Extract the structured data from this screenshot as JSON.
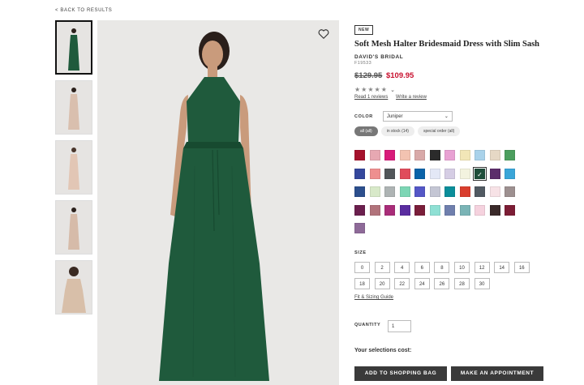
{
  "nav": {
    "back": "< BACK TO RESULTS"
  },
  "product": {
    "badge": "NEW",
    "title": "Soft Mesh Halter Bridesmaid Dress with Slim Sash",
    "brand": "DAVID'S BRIDAL",
    "sku": "F19533",
    "price_old": "$129.95",
    "price_sale": "$109.95",
    "stars": "★★★★★",
    "read_reviews": "Read 1 reviews",
    "write_review": "Write a review"
  },
  "color": {
    "label": "COLOR",
    "selected": "Juniper",
    "filters": [
      "all (all)",
      "in stock (14)",
      "special order (all)"
    ],
    "swatches": [
      "#a5122c",
      "#e7a8b2",
      "#d81b7a",
      "#f3c3b1",
      "#d8a9a8",
      "#2b2b2b",
      "#e8a1d3",
      "#f2e6b7",
      "#a9d2ea",
      "#e6d8c5",
      "#4c9e5e",
      "#34479c",
      "#ee8f8f",
      "#525659",
      "#e04c5c",
      "#0a63a8",
      "#e3e8f6",
      "#d5cde4",
      "#f3f3df",
      "#1e4d3a",
      "#5c2d6b",
      "#3aa5d8",
      "#2c4f8d",
      "#d8e9c9",
      "#aeb4b4",
      "#7dd6b5",
      "#5457c6",
      "#c4c6d4",
      "#0a8e9a",
      "#d93e2e",
      "#515a62",
      "#f7e2e6",
      "#9d9090",
      "#6b1f4e",
      "#b1737b",
      "#a92d79",
      "#5a2da0",
      "#7a1e3a",
      "#8fe0d4",
      "#6f7fad",
      "#7ab4b6",
      "#f5d2de",
      "#3a2a2a",
      "#7c1d35",
      "#8e6a98"
    ],
    "selected_index": 19
  },
  "size": {
    "label": "SIZE",
    "sizes": [
      "0",
      "2",
      "4",
      "6",
      "8",
      "10",
      "12",
      "14",
      "16",
      "18",
      "20",
      "22",
      "24",
      "26",
      "28",
      "30"
    ],
    "fit_guide": "Fit & Sizing Guide"
  },
  "quantity": {
    "label": "QUANTITY",
    "value": "1"
  },
  "cost": {
    "label": "Your selections cost:"
  },
  "buttons": {
    "add": "ADD TO SHOPPING BAG",
    "appointment": "MAKE AN APPOINTMENT"
  },
  "accent": {
    "sale": "#c8102e",
    "button": "#3a3a3a"
  }
}
